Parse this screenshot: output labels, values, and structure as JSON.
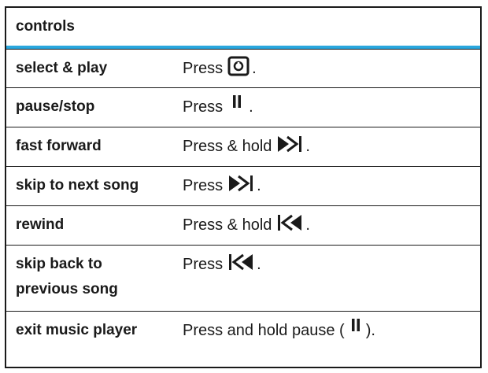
{
  "header": {
    "title": "controls"
  },
  "rows": [
    {
      "control": "select & play",
      "action": "Press",
      "icon": "center-select-key-icon",
      "suffix": "."
    },
    {
      "control": "pause/stop",
      "action": "Press",
      "icon": "pause-icon",
      "suffix": "."
    },
    {
      "control": "fast forward",
      "action": "Press & hold",
      "icon": "skip-forward-icon",
      "suffix": "."
    },
    {
      "control": "skip to next song",
      "action": "Press",
      "icon": "skip-forward-icon",
      "suffix": "."
    },
    {
      "control": "rewind",
      "action": "Press & hold",
      "icon": "skip-back-icon",
      "suffix": "."
    },
    {
      "control_line1": "skip back to",
      "control_line2": "previous song",
      "action": "Press",
      "icon": "skip-back-icon",
      "suffix": "."
    },
    {
      "control": "exit music player",
      "action": "Press and hold pause (",
      "icon": "pause-icon",
      "suffix": ")."
    }
  ],
  "colors": {
    "accent_rule": "#2aa7de",
    "text": "#1a1a1a"
  }
}
